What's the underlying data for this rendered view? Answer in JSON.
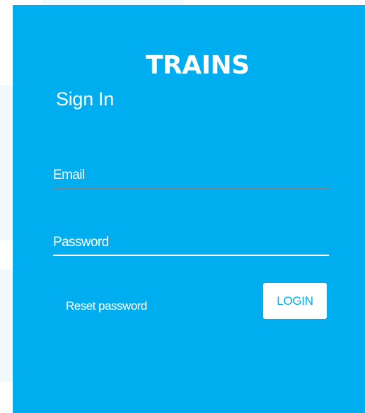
{
  "colors": {
    "card_background": "#00adef",
    "page_background": "#ffffff",
    "text": "#ffffff",
    "email_underline_active": "#6f8796",
    "button_text": "#00adef"
  },
  "brand": {
    "name": "TRAINS"
  },
  "form": {
    "heading": "Sign In",
    "email": {
      "placeholder": "Email",
      "value": ""
    },
    "password": {
      "placeholder": "Password",
      "value": ""
    },
    "reset_link": "Reset password",
    "login_button": "LOGIN"
  }
}
